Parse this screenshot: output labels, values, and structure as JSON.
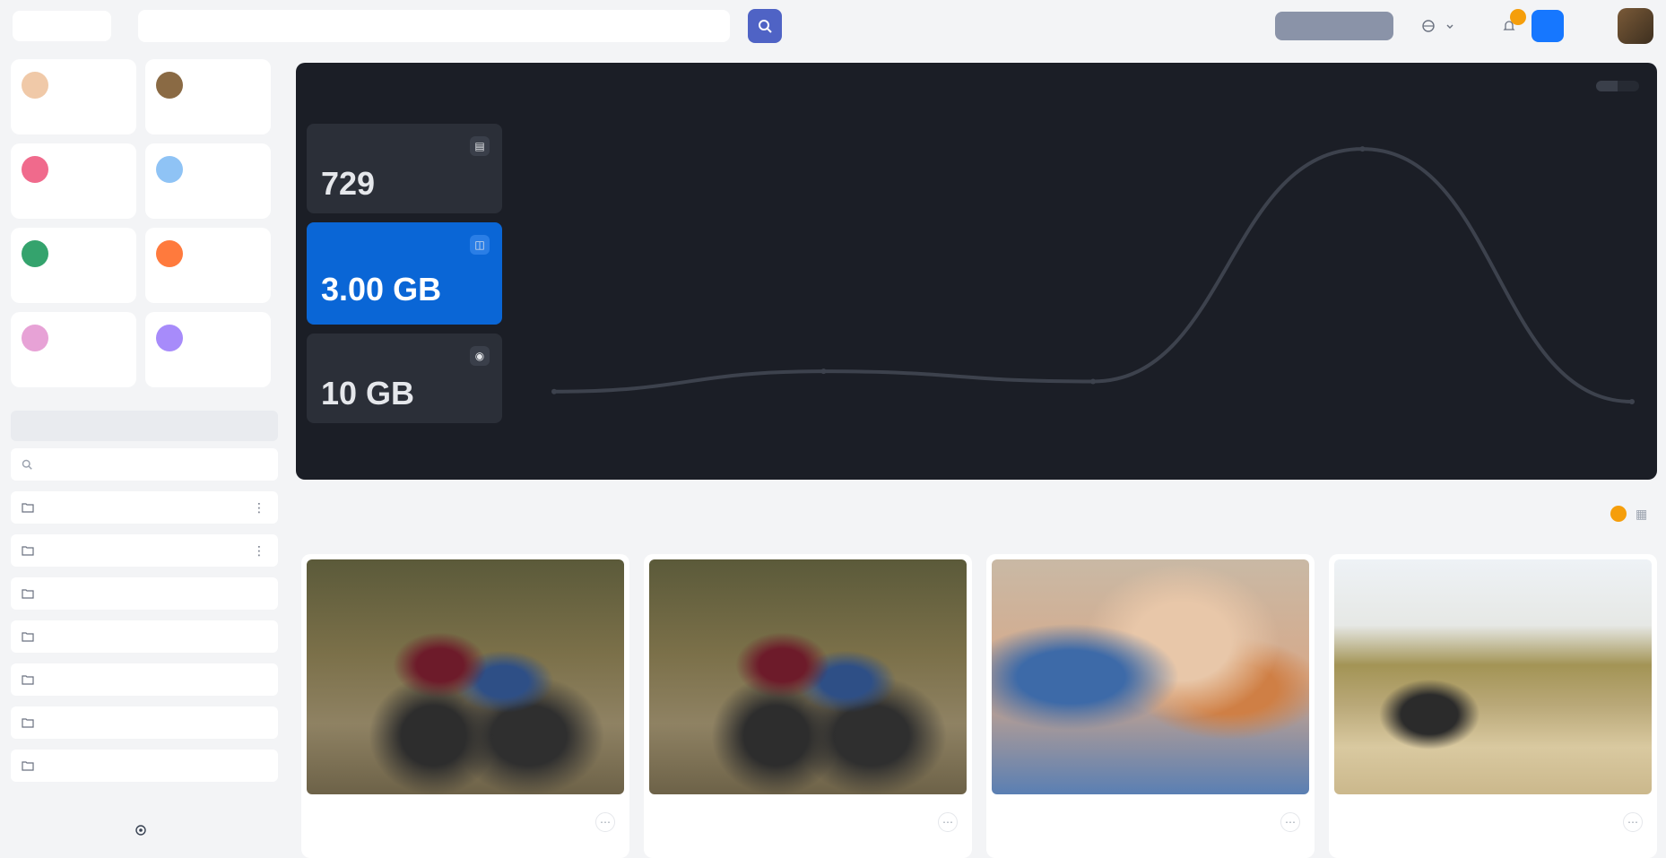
{
  "topbar": {
    "brand_label": "",
    "search_placeholder": "",
    "search_shortcut": "",
    "upload_label": "",
    "language_label": "",
    "notification_count": "",
    "user_name": "",
    "user_sub": ""
  },
  "sidebar": {
    "stats": [
      {
        "value": "",
        "label": "",
        "color": "#f0c9a8"
      },
      {
        "value": "",
        "label": "",
        "color": "#8a6a44"
      },
      {
        "value": "",
        "label": "",
        "color": "#f06a8c"
      },
      {
        "value": "",
        "label": "",
        "color": "#8fc3f5"
      },
      {
        "value": "",
        "label": "",
        "color": "#34a36d"
      },
      {
        "value": "",
        "label": "",
        "color": "#ff7a3d"
      },
      {
        "value": "",
        "label": "",
        "color": "#e7a2d6"
      },
      {
        "value": "",
        "label": "",
        "color": "#a78bfa"
      }
    ],
    "folders_title": "",
    "folder_search_placeholder": "",
    "folders": [
      {
        "label": "",
        "has_more": true
      },
      {
        "label": "",
        "has_more": true
      },
      {
        "label": "",
        "has_more": false
      },
      {
        "label": "",
        "has_more": false
      },
      {
        "label": "",
        "has_more": false
      },
      {
        "label": "",
        "has_more": false
      },
      {
        "label": "",
        "has_more": false
      }
    ],
    "manage_label": ""
  },
  "overview": {
    "title": "",
    "ranges": [
      "",
      ""
    ],
    "active_range": 0,
    "metrics": [
      {
        "label": "",
        "value": "729"
      },
      {
        "label": "",
        "value": "3.00 GB"
      },
      {
        "label": "",
        "value": "10 GB"
      }
    ],
    "active_metric": 1,
    "footer": {
      "label1": "",
      "value1": "",
      "label2": "",
      "value2": ""
    }
  },
  "chart_data": {
    "type": "line",
    "title": "",
    "x": [
      "",
      "",
      "",
      "",
      ""
    ],
    "values": [
      0.2,
      0.6,
      0.4,
      5.0,
      0.0
    ],
    "ylim": [
      0,
      5.5
    ],
    "grid": false,
    "line_color": "#3d424d"
  },
  "tabs": {
    "items": [
      "",
      ""
    ],
    "active": 1
  },
  "cards": [
    {
      "title": "",
      "thumb": "th-a"
    },
    {
      "title": "",
      "thumb": "th-a"
    },
    {
      "title": "",
      "thumb": "th-b"
    },
    {
      "title": "",
      "thumb": "th-c"
    }
  ]
}
